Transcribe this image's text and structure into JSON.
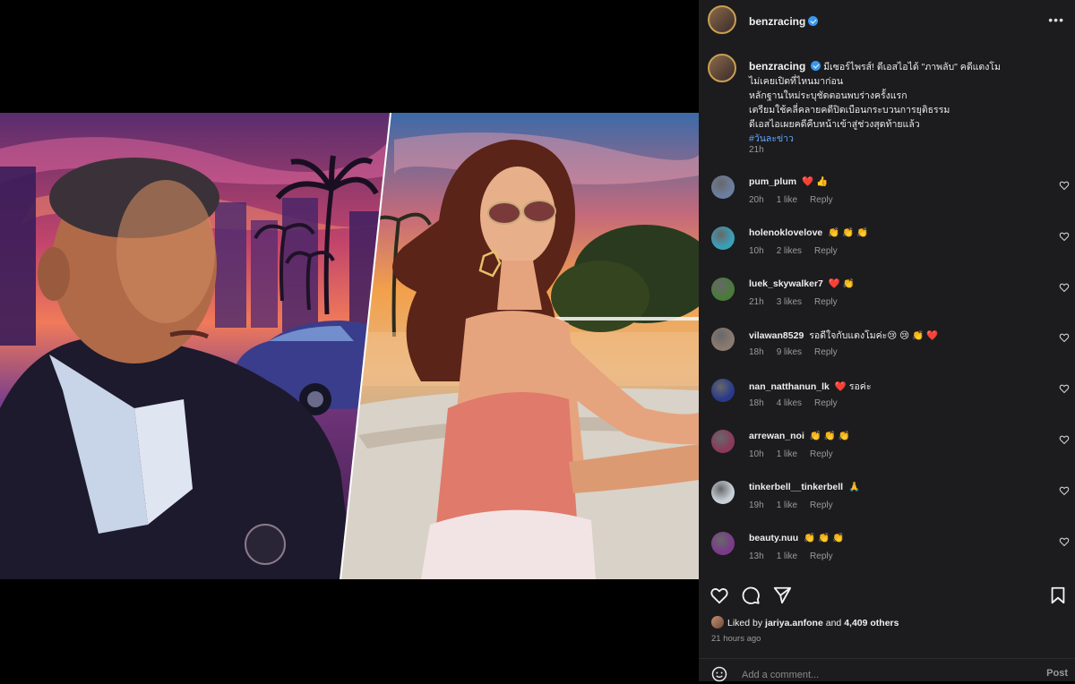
{
  "post": {
    "username": "benzracing",
    "verified": true,
    "more_icon": "more-horizontal-icon",
    "caption_lines": [
      "มีเซอร์ไพรส์! ดีเอสไอได้ \"ภาพลับ\" คดีแตงโม",
      "ไม่เคยเปิดที่ไหนมาก่อน",
      "หลักฐานใหม่ระบุชัดตอนพบร่างครั้งแรก",
      "เตรียมใช้คลี่คลายคดีปิดเบือนกระบวนการยุติธรรม",
      "ดีเอสไอเผยคดีคืบหน้าเข้าสู่ช่วงสุดท้ายแล้ว"
    ],
    "hashtag": "#วันละข่าว",
    "caption_time": "21h"
  },
  "comments": [
    {
      "user": "pum_plum",
      "text": "❤️ 👍",
      "time": "20h",
      "likes": "1 like",
      "reply": "Reply",
      "avatar_color": "#6b7fa0"
    },
    {
      "user": "holenoklovelove",
      "text": "👏 👏 👏",
      "time": "10h",
      "likes": "2 likes",
      "reply": "Reply",
      "avatar_color": "#3aa0b8"
    },
    {
      "user": "luek_skywalker7",
      "text": "❤️ 👏",
      "time": "21h",
      "likes": "3 likes",
      "reply": "Reply",
      "avatar_color": "#4a7a3a"
    },
    {
      "user": "vilawan8529",
      "text": "รอดีใจกับแตงโมค่ะ😢 😢 👏 ❤️",
      "time": "18h",
      "likes": "9 likes",
      "reply": "Reply",
      "avatar_color": "#8a7a70"
    },
    {
      "user": "nan_natthanun_lk",
      "text": "❤️ รอค่ะ",
      "time": "18h",
      "likes": "4 likes",
      "reply": "Reply",
      "avatar_color": "#2a3a8a"
    },
    {
      "user": "arrewan_noi",
      "text": "👏 👏 👏",
      "time": "10h",
      "likes": "1 like",
      "reply": "Reply",
      "avatar_color": "#8a3a5a"
    },
    {
      "user": "tinkerbell__tinkerbell",
      "text": "🙏",
      "time": "19h",
      "likes": "1 like",
      "reply": "Reply",
      "avatar_color": "#c8d0d8"
    },
    {
      "user": "beauty.nuu",
      "text": "👏 👏 👏",
      "time": "13h",
      "likes": "1 like",
      "reply": "Reply",
      "avatar_color": "#7a3a8a"
    }
  ],
  "actions": {
    "like_icon": "heart-outline-icon",
    "comment_icon": "comment-bubble-icon",
    "share_icon": "paper-plane-icon",
    "save_icon": "bookmark-icon"
  },
  "likes": {
    "prefix": "Liked by",
    "user": "jariya.anfone",
    "middle": "and",
    "others": "4,409 others"
  },
  "posted_time": "21 hours ago",
  "comment_box": {
    "placeholder": "Add a comment...",
    "post_label": "Post",
    "emoji_icon": "smiley-icon"
  },
  "colors": {
    "sidebar_bg": "#1c1c1e",
    "hashtag": "#5fa7ff",
    "verified": "#3897f0",
    "heart": "#e0245e"
  }
}
